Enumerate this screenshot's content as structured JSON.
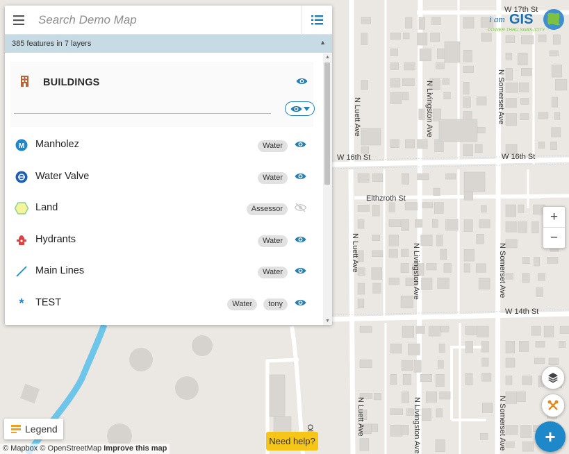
{
  "search": {
    "placeholder": "Search Demo Map"
  },
  "summary": {
    "text": "385 features in 7 layers"
  },
  "group": {
    "title": "BUILDINGS"
  },
  "layers": [
    {
      "name": "Manholez",
      "tags": [
        "Water"
      ],
      "visible": true,
      "icon": "manhole-icon"
    },
    {
      "name": "Water Valve",
      "tags": [
        "Water"
      ],
      "visible": true,
      "icon": "water-valve-icon"
    },
    {
      "name": "Land",
      "tags": [
        "Assessor"
      ],
      "visible": false,
      "icon": "hexagon-icon"
    },
    {
      "name": "Hydrants",
      "tags": [
        "Water"
      ],
      "visible": true,
      "icon": "hydrant-icon"
    },
    {
      "name": "Main Lines",
      "tags": [
        "Water"
      ],
      "visible": true,
      "icon": "line-icon"
    },
    {
      "name": "TEST",
      "tags": [
        "Water",
        "tony"
      ],
      "visible": true,
      "icon": "asterisk-icon"
    }
  ],
  "streets": {
    "w17": "W 17th St",
    "w16a": "W 16th St",
    "w16b": "W 16th St",
    "elthzroth": "Elthzroth St",
    "w14": "W 14th St",
    "luett1": "N Luett Ave",
    "luett2": "N Luett Ave",
    "luett3": "N Luett Ave",
    "livingston1": "N Livingston Ave",
    "livingston2": "N Livingston Ave",
    "livingston3": "N Livingston Ave",
    "somerset1": "N Somerset Ave",
    "somerset2": "N Somerset Ave",
    "somerset3": "N Somerset Ave",
    "oli": "Oli"
  },
  "logo": {
    "prefix": "i am",
    "brand": "GIS",
    "tagline": "POWER THRU SIMPLICITY"
  },
  "legend": {
    "label": "Legend"
  },
  "attribution": {
    "mapbox": "© Mapbox",
    "osm": "© OpenStreetMap",
    "improve": "Improve this map"
  },
  "help": {
    "label": "Need help?"
  },
  "zoom": {
    "in": "+",
    "out": "−"
  },
  "fab": {
    "label": "+"
  },
  "colors": {
    "accent": "#1f7fb6",
    "river": "#6dc5ea",
    "map_bg": "#ebe8e3",
    "help": "#f5c518",
    "fab": "#1f88c9"
  }
}
